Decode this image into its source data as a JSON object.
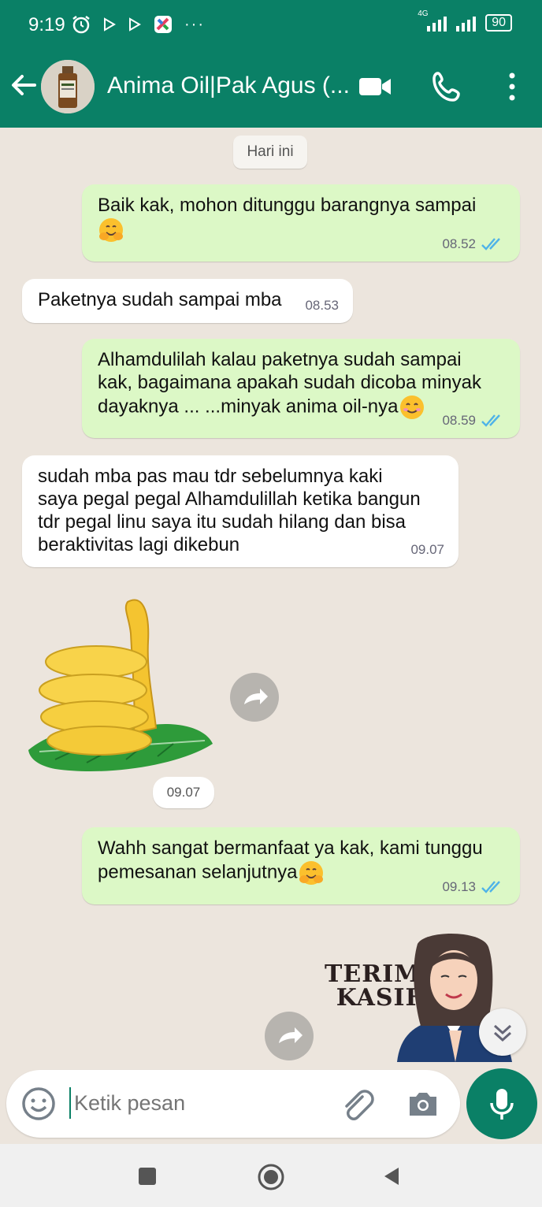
{
  "status_bar": {
    "time": "9:19",
    "network": "4G",
    "battery": "90"
  },
  "header": {
    "title": "Anima Oil|Pak Agus (..."
  },
  "chat": {
    "date_divider": "Hari ini",
    "messages": [
      {
        "direction": "out",
        "text_line1": "Baik kak, mohon ditunggu barangnya sampai",
        "time": "08.52"
      },
      {
        "direction": "in",
        "text": "Paketnya sudah sampai mba",
        "time": "08.53"
      },
      {
        "direction": "out",
        "lines": [
          "Alhamdulilah kalau paketnya sudah sampai",
          "kak, bagaimana apakah sudah dicoba minyak",
          "dayaknya ... ...minyak anima oil-nya"
        ],
        "time": "08.59"
      },
      {
        "direction": "in",
        "lines": [
          "sudah mba pas mau tdr sebelumnya kaki",
          "saya pegal pegal Alhamdulillah ketika bangun",
          "tdr pegal linu saya itu sudah hilang dan bisa",
          "beraktivitas lagi dikebun"
        ],
        "time": "09.07"
      },
      {
        "direction": "in",
        "type": "sticker",
        "sticker_name": "banana-thumbs-up",
        "time": "09.07"
      },
      {
        "direction": "out",
        "lines": [
          "Wahh sangat bermanfaat ya kak, kami tunggu",
          "pemesanan selanjutnya"
        ],
        "time": "09.13"
      },
      {
        "direction": "out",
        "type": "sticker",
        "sticker_name": "terima-kasih",
        "sticker_text": [
          "TERIMA",
          "KASIH"
        ]
      }
    ]
  },
  "input": {
    "placeholder": "Ketik pesan"
  },
  "colors": {
    "header": "#0a8066",
    "outgoing_bubble": "#dcf8c6",
    "incoming_bubble": "#ffffff",
    "background": "#ece5dd",
    "read_ticks": "#4fb3e8"
  }
}
